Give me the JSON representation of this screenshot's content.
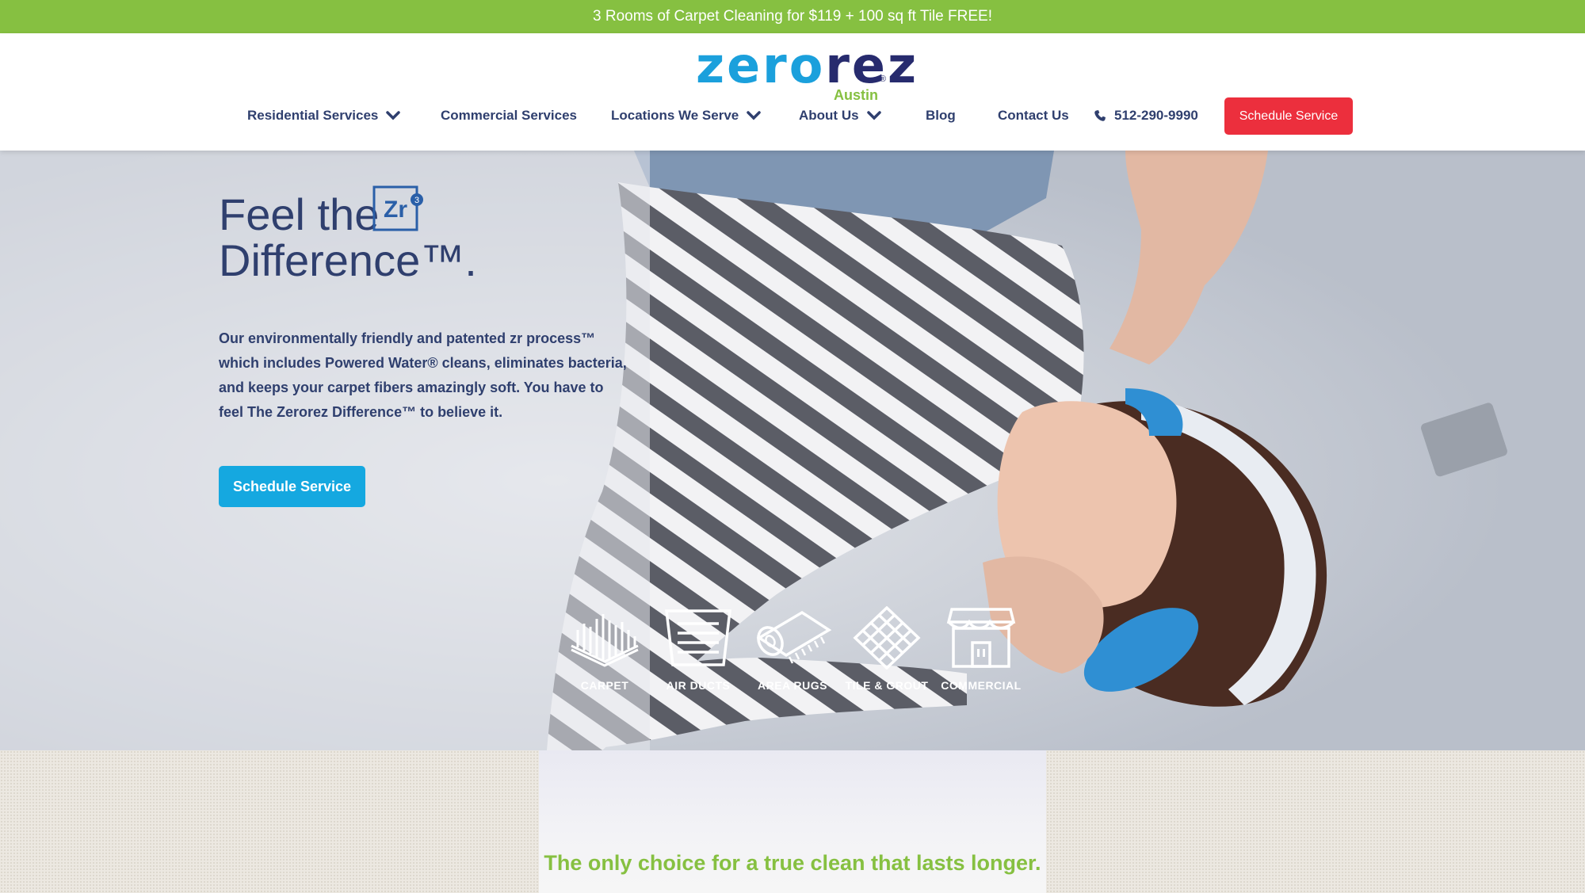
{
  "promo": {
    "text": "3 Rooms of Carpet Cleaning for $119 + 100 sq ft Tile FREE!"
  },
  "brand": {
    "word_part1": "zero",
    "word_part2": "rez",
    "registered": "®",
    "city": "Austin"
  },
  "nav": {
    "items": [
      {
        "label": "Residential Services",
        "has_dropdown": true
      },
      {
        "label": "Commercial Services",
        "has_dropdown": false
      },
      {
        "label": "Locations We Serve",
        "has_dropdown": true
      },
      {
        "label": "About Us",
        "has_dropdown": true
      },
      {
        "label": "Blog",
        "has_dropdown": false
      },
      {
        "label": "Contact Us",
        "has_dropdown": false
      }
    ],
    "phone": "512-290-9990",
    "schedule_label": "Schedule Service"
  },
  "hero": {
    "title_line1": "Feel the",
    "title_line2": "Difference™.",
    "badge_text": "Zr",
    "badge_sup": "3",
    "body": "Our environmentally friendly and patented zr process™ which includes Powered Water® cleans, eliminates bacteria, and keeps your carpet fibers amazingly soft. You have to feel The Zerorez Difference™ to believe it.",
    "cta_label": "Schedule Service"
  },
  "services": [
    {
      "label": "CARPET",
      "icon": "carpet-icon"
    },
    {
      "label": "AIR DUCTS",
      "icon": "air-duct-icon"
    },
    {
      "label": "AREA RUGS",
      "icon": "area-rug-icon"
    },
    {
      "label": "TILE & GROUT",
      "icon": "tile-grout-icon"
    },
    {
      "label": "COMMERCIAL",
      "icon": "storefront-icon"
    }
  ],
  "tagline": "The only choice for a true clean that lasts longer.",
  "colors": {
    "promo_green": "#86c041",
    "brand_blue": "#1ba0dc",
    "brand_navy": "#272b6e",
    "nav_text": "#2f3f6e",
    "cta_red": "#ec2f3d",
    "cta_blue": "#15a8e0"
  }
}
